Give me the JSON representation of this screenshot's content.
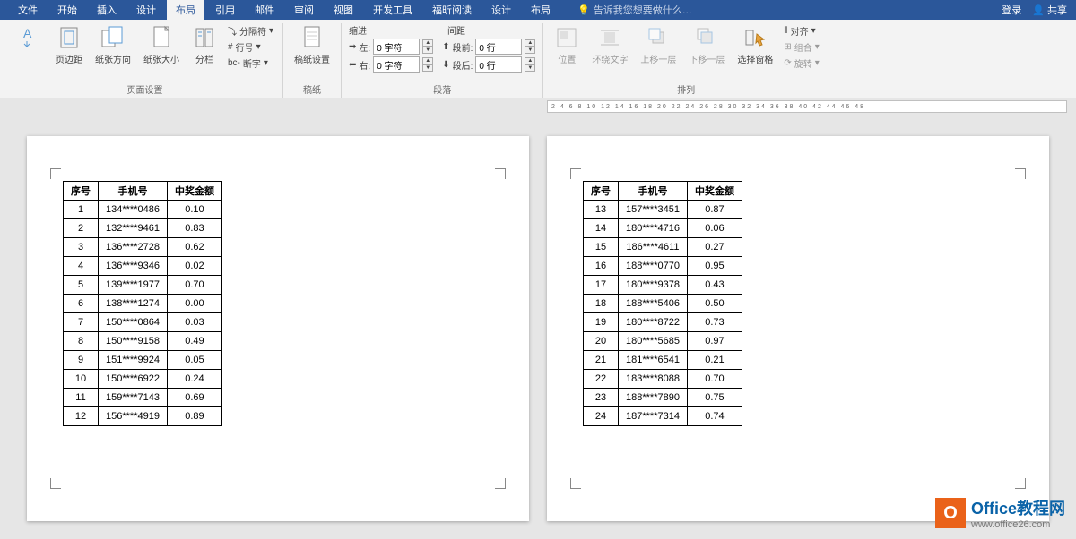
{
  "titlebar": {
    "tabs": [
      "文件",
      "开始",
      "插入",
      "设计",
      "布局",
      "引用",
      "邮件",
      "审阅",
      "视图",
      "开发工具",
      "福昕阅读",
      "设计",
      "布局"
    ],
    "active_index": 4,
    "tell_me": "告诉我您想要做什么…",
    "login": "登录",
    "share": "共享"
  },
  "ribbon": {
    "page_setup": {
      "margins": "页边距",
      "orientation": "纸张方向",
      "size": "纸张大小",
      "columns": "分栏",
      "breaks": "分隔符",
      "line_numbers": "行号",
      "hyphenation": "断字",
      "label": "页面设置"
    },
    "blank": {
      "paper": "稿纸设置",
      "label": "稿纸"
    },
    "paragraph": {
      "indent": "缩进",
      "spacing": "间距",
      "left_lbl": "左:",
      "left_val": "0 字符",
      "right_lbl": "右:",
      "right_val": "0 字符",
      "before_lbl": "段前:",
      "before_val": "0 行",
      "after_lbl": "段后:",
      "after_val": "0 行",
      "label": "段落"
    },
    "arrange": {
      "position": "位置",
      "wrap": "环绕文字",
      "forward": "上移一层",
      "backward": "下移一层",
      "selection": "选择窗格",
      "align": "对齐",
      "group": "组合",
      "rotate": "旋转",
      "label": "排列"
    }
  },
  "ruler": "2 4 6 8 10 12 14 16 18 20 22 24 26 28 30 32 34 36 38 40 42 44 46 48",
  "table": {
    "headers": [
      "序号",
      "手机号",
      "中奖金额"
    ],
    "page1": [
      [
        "1",
        "134****0486",
        "0.10"
      ],
      [
        "2",
        "132****9461",
        "0.83"
      ],
      [
        "3",
        "136****2728",
        "0.62"
      ],
      [
        "4",
        "136****9346",
        "0.02"
      ],
      [
        "5",
        "139****1977",
        "0.70"
      ],
      [
        "6",
        "138****1274",
        "0.00"
      ],
      [
        "7",
        "150****0864",
        "0.03"
      ],
      [
        "8",
        "150****9158",
        "0.49"
      ],
      [
        "9",
        "151****9924",
        "0.05"
      ],
      [
        "10",
        "150****6922",
        "0.24"
      ],
      [
        "11",
        "159****7143",
        "0.69"
      ],
      [
        "12",
        "156****4919",
        "0.89"
      ]
    ],
    "page2": [
      [
        "13",
        "157****3451",
        "0.87"
      ],
      [
        "14",
        "180****4716",
        "0.06"
      ],
      [
        "15",
        "186****4611",
        "0.27"
      ],
      [
        "16",
        "188****0770",
        "0.95"
      ],
      [
        "17",
        "180****9378",
        "0.43"
      ],
      [
        "18",
        "188****5406",
        "0.50"
      ],
      [
        "19",
        "180****8722",
        "0.73"
      ],
      [
        "20",
        "180****5685",
        "0.97"
      ],
      [
        "21",
        "181****6541",
        "0.21"
      ],
      [
        "22",
        "183****8088",
        "0.70"
      ],
      [
        "23",
        "188****7890",
        "0.75"
      ],
      [
        "24",
        "187****7314",
        "0.74"
      ]
    ]
  },
  "watermark": {
    "title": "Office教程网",
    "url": "www.office26.com"
  }
}
